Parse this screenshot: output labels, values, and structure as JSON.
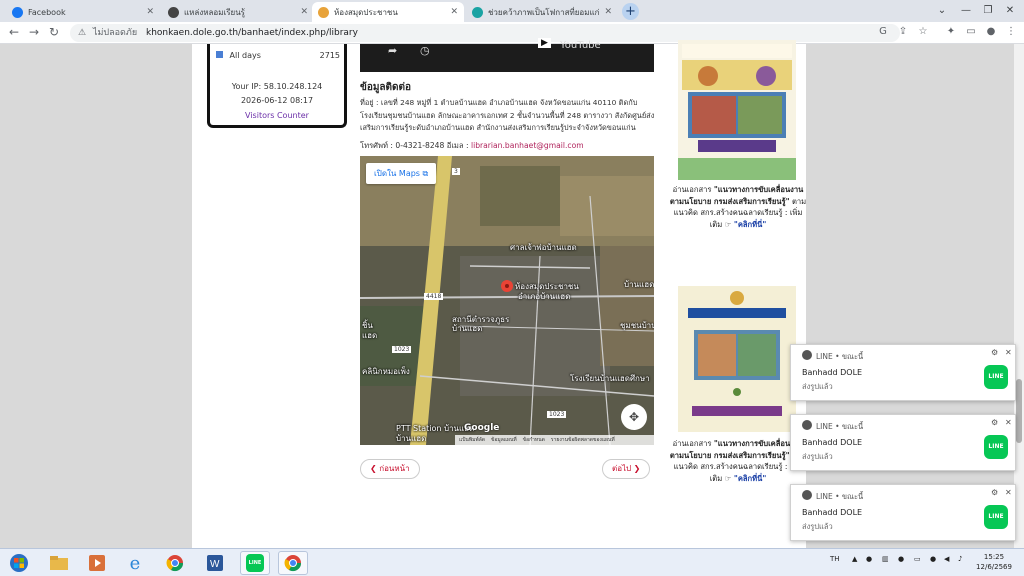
{
  "tabs": [
    {
      "title": "Facebook",
      "color": "#1877f2",
      "active": false
    },
    {
      "title": "แหล่งหลอมเรียนรู้",
      "color": "#444444",
      "active": false
    },
    {
      "title": "ห้องสมุดประชาชน",
      "color": "#e8a33a",
      "active": true
    },
    {
      "title": "ช่วยคว้าภาพเป็นโฟกาสที่ยอมแก่ตัวเอง",
      "color": "#1aa3a3",
      "active": false
    }
  ],
  "url": {
    "insecure": "ไม่ปลอดภัย",
    "address": "khonkaen.dole.go.th/banhaet/index.php/library"
  },
  "counter": {
    "row_label": "All days",
    "row_value": "2715",
    "ip": "Your IP: 58.10.248.124",
    "datetime": "2026-06-12 08:17",
    "link": "Visitors Counter"
  },
  "video": {
    "youtube": "YouTube"
  },
  "contact_section": {
    "title": "ข้อมูลติดต่อ",
    "address": "ที่อยู่ : เลขที่ 248 หมู่ที่ 1 ตำบลบ้านแฮด อำเภอบ้านแฮด จังหวัดขอนแก่น 40110 ติดกับโรงเรียนชุมชนบ้านแฮด ลักษณะอาคารเอกเทศ 2 ชั้นจำนวนพื้นที่ 248 ตารางวา สังกัดศูนย์ส่งเสริมการเรียนรู้ระดับอำเภอบ้านแฮด สำนักงานส่งเสริมการเรียนรู้ประจำจังหวัดขอนแก่น",
    "phone_label": "โทรศัพท์ : 0-4321-8248 อีเมล :",
    "email": "librarian.banhaet@gmail.com"
  },
  "map": {
    "open_label": "เปิดใน Maps",
    "labels": [
      {
        "text": "ศาลเจ้าพ่อบ้านแฮด"
      },
      {
        "text": "ห้องสมุดประชาชน"
      },
      {
        "text": "อำเภอบ้านแฮด"
      },
      {
        "text": "บ้านแฮด"
      },
      {
        "text": "ชุมชนบ้านแฮด"
      },
      {
        "text": "สถานีตำรวจภูธร"
      },
      {
        "text": "บ้านแฮด"
      },
      {
        "text": "ชิ้น"
      },
      {
        "text": "แฮด"
      },
      {
        "text": "คลินิกหมอเพ็ง"
      },
      {
        "text": "โรงเรียนบ้านแฮดศึกษา"
      },
      {
        "text": "PTT Station บ้านแฮด"
      },
      {
        "text": "บ้านแฮด"
      }
    ],
    "road_badges": [
      "4418",
      "1023",
      "1023",
      "3"
    ],
    "google": "Google",
    "footer": [
      "แป้นพิมพ์ลัด",
      "ข้อมูลแผนที่",
      "ข้อกำหนด",
      "รายงานข้อผิดพลาดของแผนที่"
    ]
  },
  "pager": {
    "prev": "ก่อนหน้า",
    "next": "ต่อไป"
  },
  "sidebar_cards": [
    {
      "text_a": "อ่านเอกสาร ",
      "text_b": "\"แนวทางการขับเคลื่อนงานตามนโยบาย กรมส่งเสริมการเรียนรู้\"",
      "text_c": " ตามแนวคิด สกร.สร้างคนฉลาดเรียนรู้ : เพิ่มเติม ☞ ",
      "more": "\"คลิกที่นี่\""
    },
    {
      "text_a": "อ่านเอกสาร ",
      "text_b": "\"แนวทางการขับเคลื่อนงานตามนโยบาย กรมส่งเสริมการเรียนรู้\"",
      "text_c": " ตามแนวคิด สกร.สร้างคนฉลาดเรียนรู้ : เพิ่มเติม ☞ ",
      "more": "\"คลิกที่นี่\""
    }
  ],
  "notifications": [
    {
      "app": "LINE • ขณะนี้",
      "title": "Banhadd   DOLE",
      "msg": "ส่งรูปแล้ว",
      "icon": "LINE"
    },
    {
      "app": "LINE • ขณะนี้",
      "title": "Banhadd   DOLE",
      "msg": "ส่งรูปแล้ว",
      "icon": "LINE"
    },
    {
      "app": "LINE • ขณะนี้",
      "title": "Banhadd   DOLE",
      "msg": "ส่งรูปแล้ว",
      "icon": "LINE"
    }
  ],
  "taskbar": {
    "lang": "TH",
    "time": "15:25",
    "date": "12/6/2569",
    "line_label": "LINE"
  }
}
